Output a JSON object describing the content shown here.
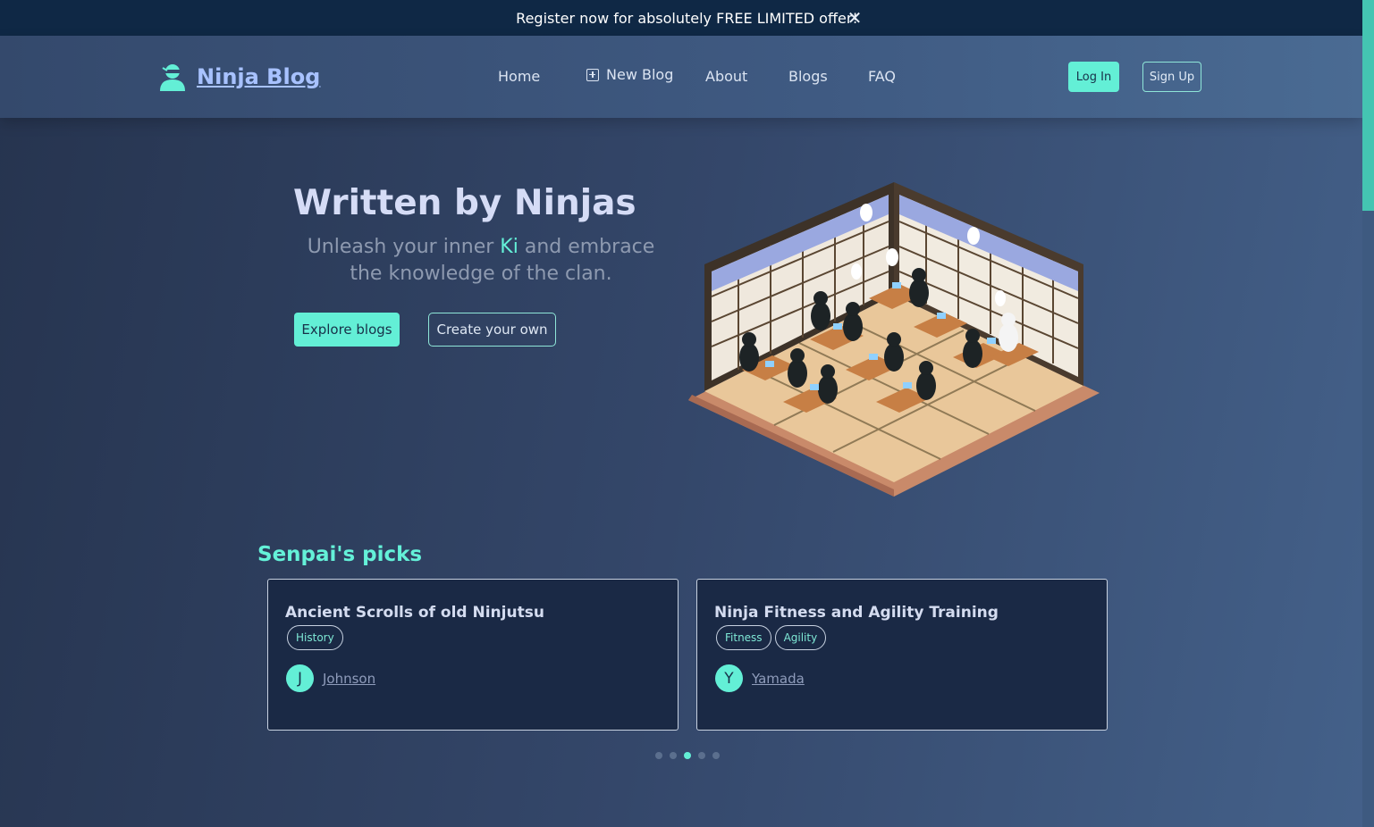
{
  "banner": {
    "text": "Register now for absolutely FREE LIMITED offer!",
    "close_symbol": "✕"
  },
  "brand": {
    "name": "Ninja Blog",
    "icon": "ninja-icon"
  },
  "nav": {
    "links": [
      {
        "label": "Home"
      },
      {
        "label": "New Blog",
        "icon": "plus-square-icon"
      },
      {
        "label": "About"
      },
      {
        "label": "Blogs"
      },
      {
        "label": "FAQ"
      }
    ],
    "login_label": "Log In",
    "signup_label": "Sign Up"
  },
  "hero": {
    "title": "Written by Ninjas",
    "subtitle_before": "Unleash your inner ",
    "subtitle_highlight": "Ki",
    "subtitle_after": " and embrace the knowledge of the clan.",
    "explore_label": "Explore blogs",
    "create_label": "Create your own",
    "illustration": "ninja-classroom-illustration"
  },
  "picks": {
    "title": "Senpai's picks",
    "cards": [
      {
        "title": "Ancient Scrolls of old Ninjutsu",
        "tags": [
          "History"
        ],
        "author_initial": "J",
        "author": "Johnson"
      },
      {
        "title": "Ninja Fitness and Agility Training",
        "tags": [
          "Fitness",
          "Agility"
        ],
        "author_initial": "Y",
        "author": "Yamada"
      }
    ],
    "pagination": {
      "total": 5,
      "active_index": 2
    }
  },
  "colors": {
    "accent": "#63efd6",
    "banner_bg": "#0f2845",
    "card_bg": "#1a2945",
    "brand_link": "#a8c2ff"
  }
}
